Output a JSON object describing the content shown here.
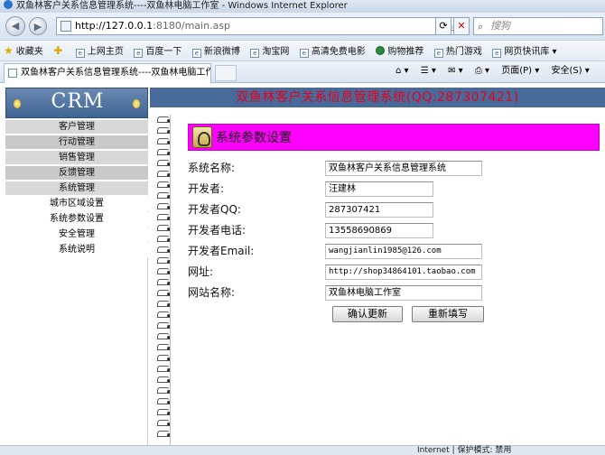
{
  "window": {
    "title": "双鱼林客户关系信息管理系统----双鱼林电脑工作室 - Windows Internet Explorer"
  },
  "address": {
    "url_main": "http://127.0.0.1",
    "url_suffix": ":8180/main.asp",
    "search_placeholder": "搜狗"
  },
  "favorites": {
    "label": "收藏夹",
    "items": [
      "上网主页",
      "百度一下",
      "新浪微博",
      "淘宝网",
      "高清免费电影",
      "购物推荐",
      "热门游戏",
      "网页快讯库 ▾"
    ]
  },
  "tabs": {
    "active_tab": "双鱼林客户关系信息管理系统----双鱼林电脑工作...",
    "page_menu": "页面(P) ▾",
    "safety_menu": "安全(S) ▾"
  },
  "left_menu": {
    "logo": "CRM",
    "items": [
      {
        "label": "客户管理",
        "type": "main"
      },
      {
        "label": "行动管理",
        "type": "main"
      },
      {
        "label": "销售管理",
        "type": "main"
      },
      {
        "label": "反馈管理",
        "type": "main"
      },
      {
        "label": "系统管理",
        "type": "main"
      },
      {
        "label": "城市区域设置",
        "type": "sub"
      },
      {
        "label": "系统参数设置",
        "type": "sub"
      },
      {
        "label": "安全管理",
        "type": "sub"
      },
      {
        "label": "系统说明",
        "type": "sub"
      }
    ]
  },
  "banner": {
    "title": "双鱼林客户关系信息管理系统(QQ:287307421)"
  },
  "panel": {
    "title": "系统参数设置"
  },
  "form": {
    "fields": [
      {
        "label": "系统名称:",
        "value": "双鱼林客户关系信息管理系统"
      },
      {
        "label": "开发者:",
        "value": "汪建林"
      },
      {
        "label": "开发者QQ:",
        "value": "287307421"
      },
      {
        "label": "开发者电话:",
        "value": "13558690869"
      },
      {
        "label": "开发者Email:",
        "value": "wangjianlin1985@126.com"
      },
      {
        "label": "网址:",
        "value": "http://shop34864101.taobao.com"
      },
      {
        "label": "网站名称:",
        "value": "双鱼林电脑工作室"
      }
    ],
    "submit_label": "确认更新",
    "reset_label": "重新填写"
  },
  "status": {
    "zone": "Internet | 保护模式: 禁用"
  }
}
